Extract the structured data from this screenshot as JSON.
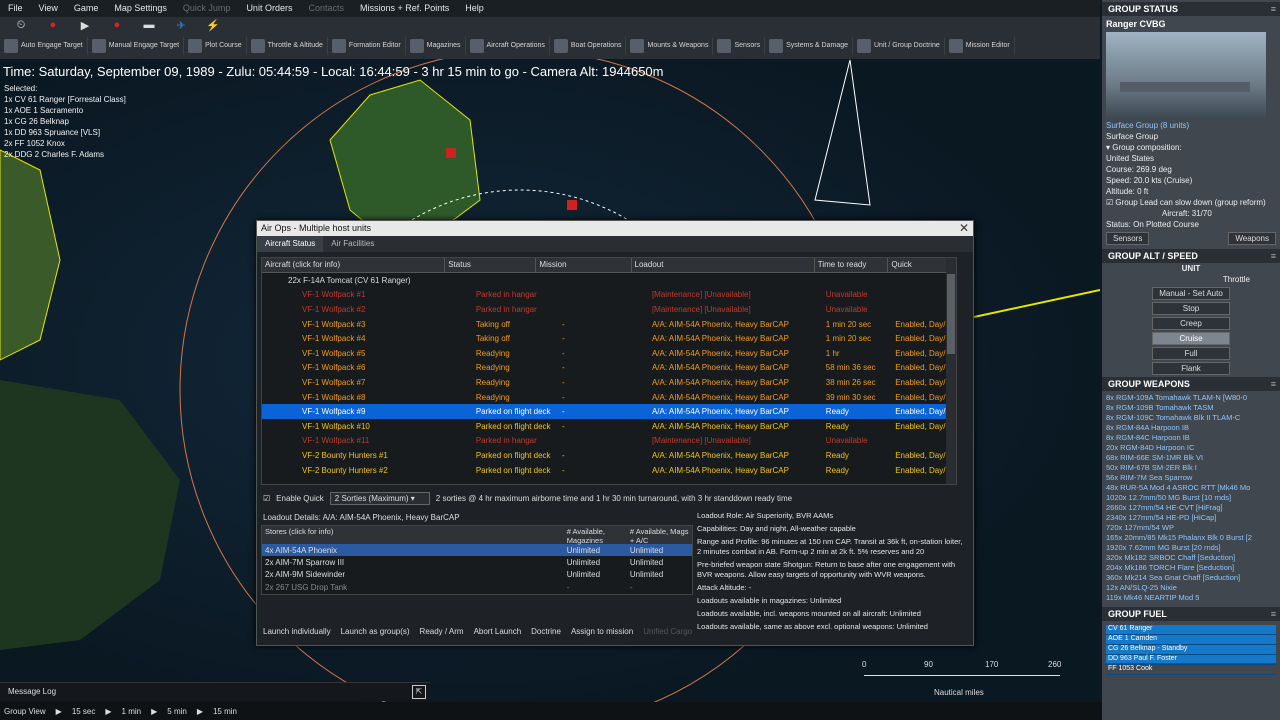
{
  "menubar": [
    "File",
    "View",
    "Game",
    "Map Settings",
    "Quick Jump",
    "Unit Orders",
    "Contacts",
    "Missions + Ref. Points",
    "Help"
  ],
  "menubar_disabled": [
    "Quick Jump",
    "Contacts"
  ],
  "toolbar": [
    {
      "label": "Auto Engage Target",
      "icon": "crosshair-icon"
    },
    {
      "label": "Manual Engage Target",
      "icon": "target-icon"
    },
    {
      "label": "Plot Course",
      "icon": "course-icon"
    },
    {
      "label": "Throttle & Altitude",
      "icon": "throttle-icon"
    },
    {
      "label": "Formation Editor",
      "icon": "formation-icon"
    },
    {
      "label": "Magazines",
      "icon": "magazine-icon"
    },
    {
      "label": "Aircraft Operations",
      "icon": "aircraft-icon"
    },
    {
      "label": "Boat Operations",
      "icon": "boat-icon"
    },
    {
      "label": "Mounts & Weapons",
      "icon": "weapons-icon"
    },
    {
      "label": "Sensors",
      "icon": "radar-icon"
    },
    {
      "label": "Systems & Damage",
      "icon": "gear-icon"
    },
    {
      "label": "Unit / Group Doctrine",
      "icon": "doctrine-icon"
    },
    {
      "label": "Mission Editor",
      "icon": "mission-icon"
    }
  ],
  "time": "Time: Saturday, September 09, 1989 - Zulu: 05:44:59 - Local: 16:44:59 - 3 hr 15 min to go - Camera Alt: 1944650m",
  "selected": {
    "label": "Selected:",
    "items": [
      "1x CV 61 Ranger [Forrestal Class]",
      "1x AOE 1 Sacramento",
      "1x CG 26 Belknap",
      "1x DD 963 Spruance [VLS]",
      "2x FF 1052 Knox",
      "2x DDG 2 Charles F. Adams"
    ]
  },
  "airops": {
    "title": "Air Ops - Multiple host units",
    "tabs": [
      "Aircraft Status",
      "Air Facilities"
    ],
    "columns": [
      "Aircraft (click for info)",
      "Status",
      "Mission",
      "Loadout",
      "Time to ready",
      "Quick"
    ],
    "rows": [
      {
        "c": [
          "22x F-14A Tomcat (CV 61 Ranger)",
          "",
          "",
          "",
          "",
          ""
        ],
        "type": "group"
      },
      {
        "c": [
          "VF-1 Wolfpack #1",
          "Parked in hangar",
          "",
          "[Maintenance] [Unavailable]",
          "Unavailable",
          ""
        ],
        "type": "maint"
      },
      {
        "c": [
          "VF-1 Wolfpack #2",
          "Parked in hangar",
          "",
          "[Maintenance] [Unavailable]",
          "Unavailable",
          ""
        ],
        "type": "maint"
      },
      {
        "c": [
          "VF-1 Wolfpack #3",
          "Taking off",
          "-",
          "A/A: AIM-54A Phoenix, Heavy BarCAP",
          "1 min 20 sec",
          "Enabled, Day/..."
        ],
        "type": "busy"
      },
      {
        "c": [
          "VF-1 Wolfpack #4",
          "Taking off",
          "-",
          "A/A: AIM-54A Phoenix, Heavy BarCAP",
          "1 min 20 sec",
          "Enabled, Day/..."
        ],
        "type": "busy"
      },
      {
        "c": [
          "VF-1 Wolfpack #5",
          "Readying",
          "-",
          "A/A: AIM-54A Phoenix, Heavy BarCAP",
          "1 hr",
          "Enabled, Day/..."
        ],
        "type": "busy"
      },
      {
        "c": [
          "VF-1 Wolfpack #6",
          "Readying",
          "-",
          "A/A: AIM-54A Phoenix, Heavy BarCAP",
          "58 min 36 sec",
          "Enabled, Day/..."
        ],
        "type": "busy"
      },
      {
        "c": [
          "VF-1 Wolfpack #7",
          "Readying",
          "-",
          "A/A: AIM-54A Phoenix, Heavy BarCAP",
          "38 min 26 sec",
          "Enabled, Day/..."
        ],
        "type": "busy"
      },
      {
        "c": [
          "VF-1 Wolfpack #8",
          "Readying",
          "-",
          "A/A: AIM-54A Phoenix, Heavy BarCAP",
          "39 min 30 sec",
          "Enabled, Day/..."
        ],
        "type": "busy"
      },
      {
        "c": [
          "VF-1 Wolfpack #9",
          "Parked on flight deck",
          "-",
          "A/A: AIM-54A Phoenix, Heavy BarCAP",
          "Ready",
          "Enabled, Day/..."
        ],
        "type": "sel"
      },
      {
        "c": [
          "VF-1 Wolfpack #10",
          "Parked on flight deck",
          "-",
          "A/A: AIM-54A Phoenix, Heavy BarCAP",
          "Ready",
          "Enabled, Day/..."
        ],
        "type": "ready"
      },
      {
        "c": [
          "VF-1 Wolfpack #11",
          "Parked in hangar",
          "",
          "[Maintenance] [Unavailable]",
          "Unavailable",
          ""
        ],
        "type": "maint"
      },
      {
        "c": [
          "VF-2 Bounty Hunters #1",
          "Parked on flight deck",
          "-",
          "A/A: AIM-54A Phoenix, Heavy BarCAP",
          "Ready",
          "Enabled, Day/..."
        ],
        "type": "ready"
      },
      {
        "c": [
          "VF-2 Bounty Hunters #2",
          "Parked on flight deck",
          "-",
          "A/A: AIM-54A Phoenix, Heavy BarCAP",
          "Ready",
          "Enabled, Day/..."
        ],
        "type": "ready"
      }
    ],
    "enable_quick": "Enable Quick",
    "sorties": "2 Sorties (Maximum)",
    "sortie_note": "2 sorties @ 4 hr maximum airborne time and 1 hr 30 min turnaround, with 3 hr standdown ready time",
    "loadout_details": "Loadout Details: A/A: AIM-54A Phoenix, Heavy BarCAP",
    "stores_cols": [
      "Stores (click for info)",
      "# Available, Magazines",
      "# Available, Mags + A/C"
    ],
    "stores": [
      [
        "4x AIM-54A Phoenix",
        "Unlimited",
        "Unlimited"
      ],
      [
        "2x AIM-7M Sparrow III",
        "Unlimited",
        "Unlimited"
      ],
      [
        "2x AIM-9M Sidewinder",
        "Unlimited",
        "Unlimited"
      ],
      [
        "2x 267 USG Drop Tank",
        "-",
        "-"
      ]
    ],
    "role_lines": [
      "Loadout Role: Air Superiority, BVR AAMs",
      "Capabilities: Day and night, All-weather capable",
      "Range and Profile: 96 minutes at 150 nm CAP. Transit at 36k ft, on-station loiter, 2 minutes combat in AB. Form-up 2 min at 2k ft. 5% reserves and 20",
      "Pre-briefed weapon state Shotgun: Return to base after one engagement with BVR weapons. Allow easy targets of opportunity with WVR weapons.",
      "Attack Altitude: -",
      "Loadouts available in magazines: Unlimited",
      "Loadouts available, incl. weapons mounted on all aircraft: Unlimited",
      "Loadouts available, same as above excl. optional weapons: Unlimited"
    ],
    "footer": [
      "Launch individually",
      "Launch as group(s)",
      "Ready / Arm",
      "Abort Launch",
      "Doctrine",
      "Assign to mission",
      "Unified Cargo"
    ]
  },
  "message_log": "Message Log",
  "bottom": [
    "Group View",
    "15 sec",
    "1 min",
    "5 min",
    "15 min"
  ],
  "scale": {
    "ticks": [
      "0",
      "90",
      "170",
      "260"
    ],
    "unit": "Nautical miles"
  },
  "right": {
    "status_header": "GROUP STATUS",
    "group_name": "Ranger CVBG",
    "group_link": "Surface Group (8 units)",
    "group_type": "Surface Group",
    "composition": "Group composition:",
    "country": "United States",
    "course": "Course: 269.9 deg",
    "speed": "Speed: 20.0 kts (Cruise)",
    "altitude": "Altitude: 0 ft",
    "slowdown": "Group Lead can slow down (group reform)",
    "aircraft": "Aircraft: 31/70",
    "status": "Status: On Plotted Course",
    "sensors_btn": "Sensors",
    "weapons_btn": "Weapons",
    "alt_header": "GROUP ALT / SPEED",
    "unit_label": "UNIT",
    "throttle_label": "Throttle",
    "throttle_mode": "Manual - Set Auto",
    "speeds": [
      "Stop",
      "Creep",
      "Cruise",
      "Full",
      "Flank"
    ],
    "active_speed": "Cruise",
    "weapons_header": "GROUP WEAPONS",
    "weapons": [
      "8x RGM-109A Tomahawk TLAM-N [W80-0",
      "8x RGM-109B Tomahawk TASM",
      "8x RGM-109C Tomahawk Blk II TLAM-C",
      "8x RGM-84A Harpoon IB",
      "8x RGM-84C Harpoon IB",
      "20x RGM-84D Harpoon IC",
      "68x RIM-66E SM-1MR Blk VI",
      "50x RIM-67B SM-2ER Blk I",
      "56x RIM-7M Sea Sparrow",
      "48x RUR-5A Mod 4 ASROC RTT [Mk46 Mo",
      "1020x 12.7mm/50 MG Burst [10 rnds]",
      "2660x 127mm/54 HE-CVT [HiFrag]",
      "2340x 127mm/54 HE-PD [HiCap]",
      "720x 127mm/54 WP",
      "165x 20mm/85 Mk15 Phalanx Blk 0 Burst [2",
      "1920x 7.62mm MG Burst [20 rnds]",
      "320x Mk182 SRBOC Chaff [Seduction]",
      "204x Mk186 TORCH Flare [Seduction]",
      "360x Mk214 Sea Gnat Chaff [Seduction]",
      "12x AN/SLQ-25 Nixie",
      "119x Mk46 NEARTIP Mod 5"
    ],
    "fuel_header": "GROUP FUEL",
    "fuel": [
      "CV 61 Ranger",
      "AOE 1 Camden",
      "CG 26 Belknap - Standby",
      "DD 963 Paul F. Foster",
      "FF 1053 Cook"
    ]
  },
  "colors": {
    "selected_row": "#0a64d8",
    "maint": "#c0392b",
    "busy": "#f39c12",
    "ready": "#f1c40f"
  }
}
